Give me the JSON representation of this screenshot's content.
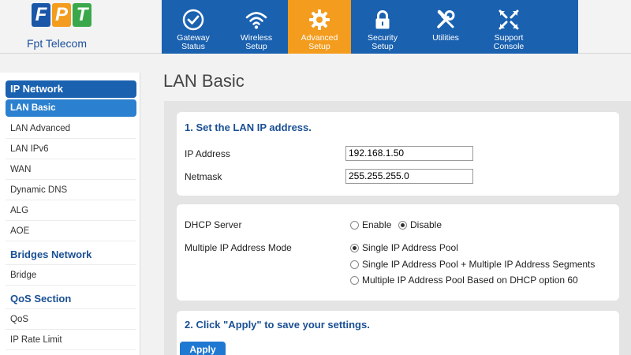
{
  "brand": {
    "logo_letters": [
      "F",
      "P",
      "T"
    ],
    "logo_colors": [
      "#1b57a8",
      "#f39c1e",
      "#3aa84a"
    ],
    "logo_text": "Fpt Telecom"
  },
  "nav": {
    "active_color": "#f39c1e",
    "bar_color": "#1a61b0",
    "items": [
      {
        "label": "Gateway\nStatus",
        "icon": "checkmark-circle-icon"
      },
      {
        "label": "Wireless\nSetup",
        "icon": "wifi-icon"
      },
      {
        "label": "Advanced\nSetup",
        "icon": "gear-icon",
        "active": true
      },
      {
        "label": "Security\nSetup",
        "icon": "lock-icon"
      },
      {
        "label": "Utilities",
        "icon": "tools-icon"
      },
      {
        "label": "Support\nConsole",
        "icon": "support-arrows-icon"
      }
    ]
  },
  "sidebar": {
    "section_ip": "IP Network",
    "ip_items": [
      "LAN Basic",
      "LAN Advanced",
      "LAN IPv6",
      "WAN",
      "Dynamic DNS",
      "ALG",
      "AOE"
    ],
    "section_bridges": "Bridges Network",
    "bridges_items": [
      "Bridge"
    ],
    "section_qos": "QoS Section",
    "qos_items": [
      "QoS",
      "IP Rate Limit"
    ]
  },
  "main": {
    "page_title": "LAN Basic",
    "card1": {
      "title": "1. Set the LAN IP address.",
      "ip_label": "IP Address",
      "ip_value": "192.168.1.50",
      "netmask_label": "Netmask",
      "netmask_value": "255.255.255.0"
    },
    "card2": {
      "dhcp_label": "DHCP Server",
      "dhcp_enable": "Enable",
      "dhcp_disable": "Disable",
      "mode_label": "Multiple IP Address Mode",
      "mode_options": [
        "Single IP Address Pool",
        "Single IP Address Pool + Multiple IP Address Segments",
        "Multiple IP Address Pool Based on DHCP option 60"
      ]
    },
    "card3": {
      "title": "2. Click \"Apply\" to save your settings.",
      "apply_label": "Apply"
    }
  }
}
